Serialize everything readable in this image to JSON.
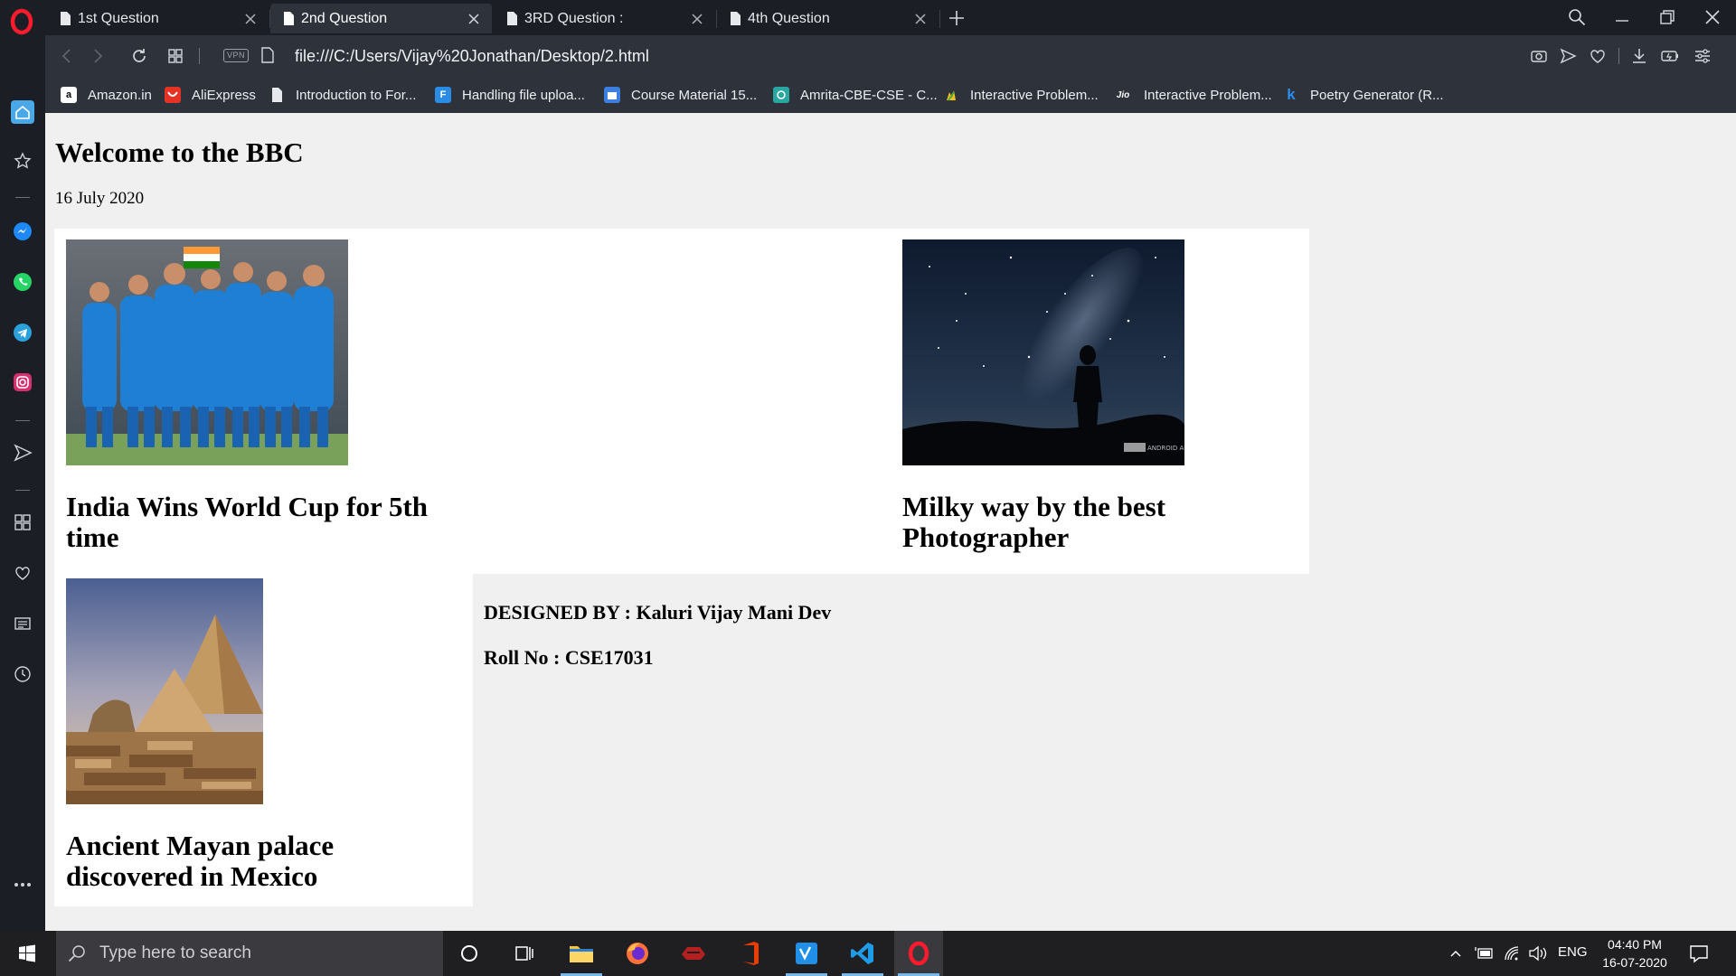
{
  "browser": {
    "tabs": [
      {
        "label": "1st Question",
        "active": false
      },
      {
        "label": "2nd Question",
        "active": true
      },
      {
        "label": "3RD Question :",
        "active": false
      },
      {
        "label": "4th Question",
        "active": false
      }
    ],
    "vpn_label": "VPN",
    "url": "file:///C:/Users/Vijay%20Jonathan/Desktop/2.html",
    "bookmarks": [
      {
        "label": "Amazon.in",
        "icon": "amazon-icon"
      },
      {
        "label": "AliExpress",
        "icon": "aliexpress-icon"
      },
      {
        "label": "Introduction to For...",
        "icon": "page-icon"
      },
      {
        "label": "Handling file uploa...",
        "icon": "formidable-icon"
      },
      {
        "label": "Course Material 15...",
        "icon": "calendar-icon"
      },
      {
        "label": "Amrita-CBE-CSE - C...",
        "icon": "amrita-icon"
      },
      {
        "label": "Interactive Problem...",
        "icon": "hand-icon"
      },
      {
        "label": "Interactive Problem...",
        "icon": "jio-icon"
      },
      {
        "label": "Poetry Generator (R...",
        "icon": "k-icon"
      }
    ],
    "jio_text": "Jio",
    "amazon_text": "a",
    "formidable_text": "F",
    "k_text": "k"
  },
  "page": {
    "title": "Welcome to the BBC",
    "date": "16 July 2020",
    "articles": [
      {
        "headline": "India Wins World Cup for 5th time",
        "image": "cricket-team-photo"
      },
      {
        "headline": "Milky way by the best Photographer",
        "image": "milky-way-photo"
      },
      {
        "headline": "Ancient Mayan palace discovered in Mexico",
        "image": "pyramids-photo"
      }
    ],
    "designed_by": "DESIGNED BY : Kaluri Vijay Mani Dev",
    "roll_no": "Roll No : CSE17031",
    "photo_watermark": "ANDROID AUTHORITY"
  },
  "taskbar": {
    "search_placeholder": "Type here to search",
    "apps": [
      "cortana-icon",
      "task-view-icon",
      "file-explorer-icon",
      "firefox-icon",
      "gaming-icon",
      "office-icon",
      "visual-studio-icon",
      "vscode-icon",
      "opera-icon"
    ],
    "language": "ENG",
    "time": "04:40 PM",
    "date": "16-07-2020"
  },
  "colors": {
    "opera_red": "#ff1b2d",
    "tab_active": "#2d323b",
    "page_bg": "#f0f0f0",
    "taskbar": "#1f1f22"
  }
}
